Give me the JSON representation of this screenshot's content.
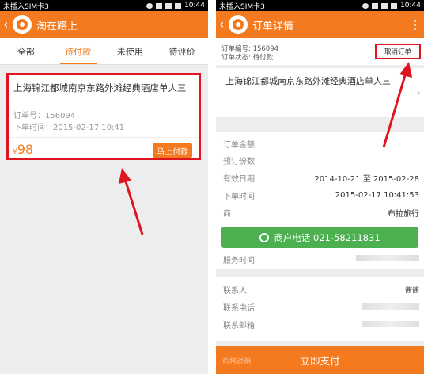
{
  "left": {
    "status_bar": {
      "carrier": "未插入SIM卡3",
      "time": "10:44"
    },
    "appbar": {
      "title": "淘在路上"
    },
    "tabs": [
      {
        "label": "全部"
      },
      {
        "label": "待付款"
      },
      {
        "label": "未使用"
      },
      {
        "label": "待评价"
      }
    ],
    "order": {
      "hotel": "上海锦江都城南京东路外滩经典酒店单人三",
      "order_no": "订单号：156094",
      "order_time": "下单时间：2015-02-17 10:41",
      "currency": "¥",
      "price": "98",
      "pay_label": "马上付款"
    }
  },
  "right": {
    "status_bar": {
      "carrier": "未插入SIM卡3",
      "time": "10:44"
    },
    "appbar": {
      "title": "订单详情"
    },
    "header": {
      "order_no": "订单编号: 156094",
      "order_status": "订单状态: 待付款",
      "cancel_label": "取消订单"
    },
    "hotel": "上海锦江都城南京东路外滩经典酒店单人三",
    "details": [
      {
        "key": "订单金额",
        "value": ""
      },
      {
        "key": "预订份数",
        "value": ""
      },
      {
        "key": "有效日期",
        "value": "2014-10-21 至 2015-02-28"
      },
      {
        "key": "下单时间",
        "value": "2015-02-17 10:41:53"
      },
      {
        "key": "商",
        "value": "布拉旅行"
      }
    ],
    "call_label": "商户电话 021-58211831",
    "service_label": "服务时间",
    "contact": [
      {
        "key": "联系人",
        "value": "酱酱"
      },
      {
        "key": "联系电话",
        "value": ""
      },
      {
        "key": "联系邮箱",
        "value": ""
      }
    ],
    "pay_label": "立即支付",
    "pay_left_label": "价格说明"
  },
  "colors": {
    "brand": "#f47a20",
    "annotation": "#e0141e",
    "call": "#4caf50"
  }
}
